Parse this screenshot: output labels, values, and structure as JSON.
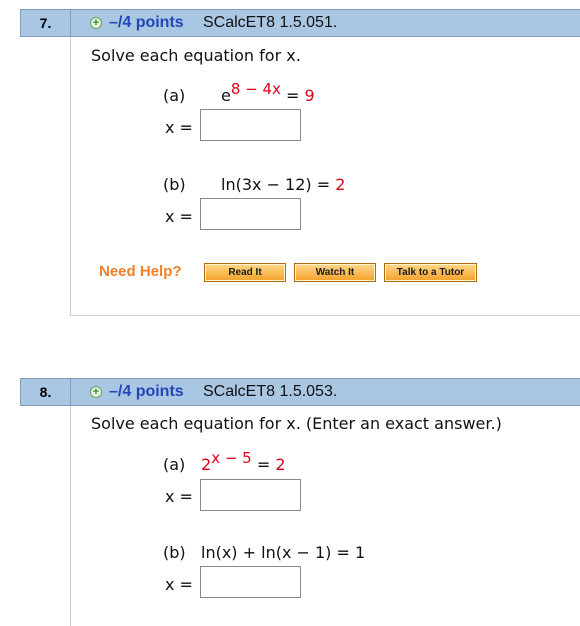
{
  "questions": [
    {
      "number": "7.",
      "points": "–/4 points",
      "id": "SCalcET8 1.5.051.",
      "instruction": "Solve each equation for x.",
      "parts": [
        {
          "label": "(a)",
          "eq_base": "e",
          "eq_exp": "8 − 4x",
          "eq_rhs": "= ",
          "eq_val": "9",
          "answer_label": "x =",
          "answer_value": ""
        },
        {
          "label": "(b)",
          "eq_text": "ln(3x − 12) = ",
          "eq_val": "2",
          "answer_label": "x =",
          "answer_value": ""
        }
      ],
      "help": {
        "label": "Need Help?",
        "buttons": [
          "Read It",
          "Watch It",
          "Talk to a Tutor"
        ]
      }
    },
    {
      "number": "8.",
      "points": "–/4 points",
      "id": "SCalcET8 1.5.053.",
      "instruction": "Solve each equation for x. (Enter an exact answer.)",
      "parts": [
        {
          "label": "(a)",
          "eq_base": "2",
          "eq_exp": "x − 5",
          "eq_rhs": "= ",
          "eq_val": "2",
          "answer_label": "x =",
          "answer_value": ""
        },
        {
          "label": "(b)",
          "eq_text": "ln(x) + ln(x − 1) = 1",
          "answer_label": "x =",
          "answer_value": ""
        }
      ]
    }
  ],
  "colors": {
    "header_bg": "#a9c6e2",
    "points": "#2346b8",
    "red": "#e0001a",
    "help": "#f0802a"
  }
}
